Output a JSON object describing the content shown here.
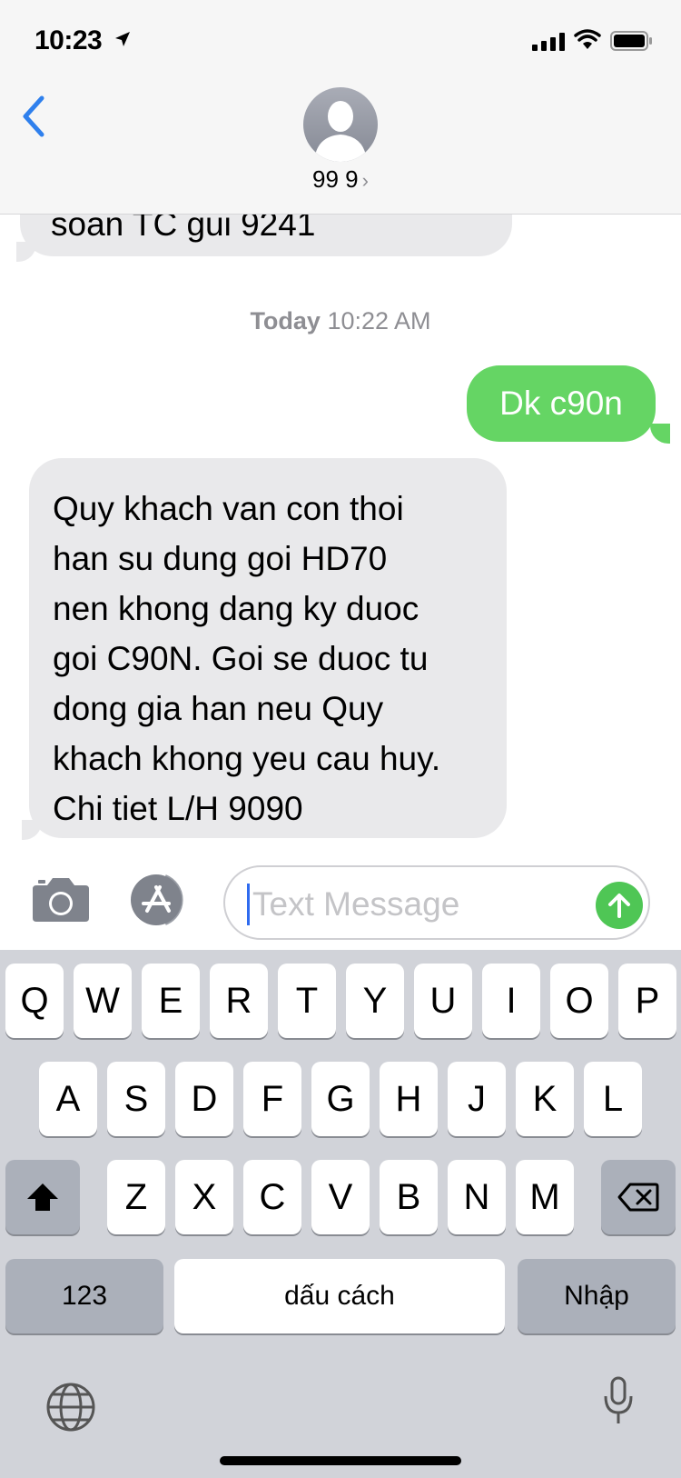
{
  "status_bar": {
    "time": "10:23"
  },
  "header": {
    "contact_name": "99 9",
    "contact_chevron": "›"
  },
  "messages": {
    "partial_incoming": "soan TC gui 9241",
    "timestamp_day": "Today",
    "timestamp_time": "10:22 AM",
    "outgoing": "Dk c90n",
    "incoming_lines": [
      "Quy khach van con thoi",
      "han su dung goi HD70",
      "nen khong dang ky duoc",
      "goi C90N. Goi se duoc tu",
      "dong gia han neu Quy",
      "khach khong yeu cau huy.",
      "Chi tiet L/H 9090"
    ]
  },
  "input": {
    "placeholder": "Text Message"
  },
  "keyboard": {
    "row1": [
      "Q",
      "W",
      "E",
      "R",
      "T",
      "Y",
      "U",
      "I",
      "O",
      "P"
    ],
    "row2": [
      "A",
      "S",
      "D",
      "F",
      "G",
      "H",
      "J",
      "K",
      "L"
    ],
    "row3": [
      "Z",
      "X",
      "C",
      "V",
      "B",
      "N",
      "M"
    ],
    "numbers_key": "123",
    "space_key": "dấu cách",
    "return_key": "Nhập"
  },
  "colors": {
    "accent_blue": "#2f80ed",
    "outgoing_bubble": "#65d564",
    "incoming_bubble": "#e9e9eb",
    "send_button": "#4fc655"
  }
}
